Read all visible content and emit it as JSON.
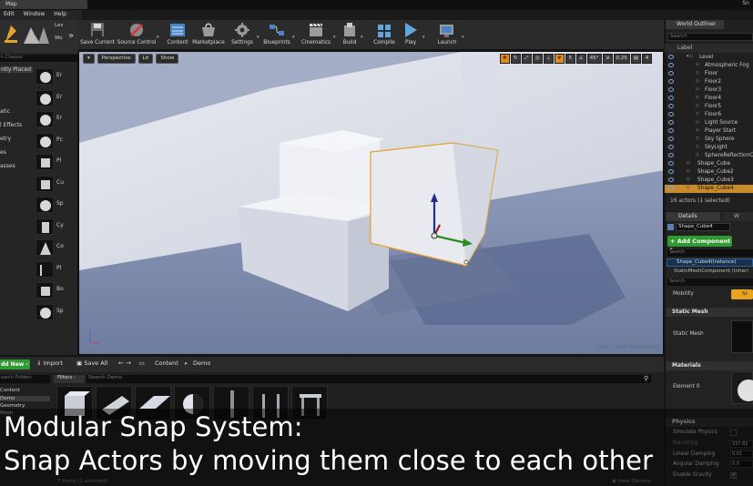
{
  "window": {
    "tab_title": "Map",
    "right_text": "Sn",
    "menu": [
      "Edit",
      "Window",
      "Help"
    ]
  },
  "modes": {
    "tabs": [
      "select-mode",
      "landscape-mode",
      "foliage-mode",
      "mesh-paint-mode"
    ],
    "tab_labels": [
      "Lev",
      "Wo"
    ],
    "search_placeholder": "h Classes",
    "categories": [
      {
        "label": "ntly Placed",
        "selected": true
      },
      {
        "label": ""
      },
      {
        "label": "atic"
      },
      {
        "label": "l Effects"
      },
      {
        "label": "etry"
      },
      {
        "label": "es"
      },
      {
        "label": "asses"
      }
    ],
    "assets": [
      "Er",
      "Er",
      "Er",
      "Pc",
      "Pl",
      "Cu",
      "Sp",
      "Cy",
      "Co",
      "Pl",
      "Bo",
      "Sp"
    ]
  },
  "toolbar": {
    "buttons": [
      {
        "label": "Save Current",
        "icon": "save-icon"
      },
      {
        "label": "Source Control",
        "icon": "source-control-icon"
      },
      {
        "label": "Content",
        "icon": "content-icon"
      },
      {
        "label": "Marketplace",
        "icon": "marketplace-icon"
      },
      {
        "label": "Settings",
        "icon": "settings-icon"
      },
      {
        "label": "Blueprints",
        "icon": "blueprints-icon"
      },
      {
        "label": "Cinematics",
        "icon": "cinematics-icon"
      },
      {
        "label": "Build",
        "icon": "build-icon"
      },
      {
        "label": "Compile",
        "icon": "compile-icon"
      },
      {
        "label": "Play",
        "icon": "play-icon"
      },
      {
        "label": "Launch",
        "icon": "launch-icon"
      }
    ]
  },
  "viewport": {
    "perspective_label": "Perspective",
    "lit_label": "Lit",
    "show_label": "Show",
    "grid_snap_value": "5",
    "rotation_snap_value": "45°",
    "scale_snap_value": "0.25",
    "camera_speed_value": "4",
    "level_label": "Level:  Map (Persistent)",
    "gizmo_colors": {
      "z": "#1f2d8c",
      "x": "#2d8c1f",
      "y": "#8c1f1f",
      "selection": "#e6a12a"
    }
  },
  "outliner": {
    "tab_label": "World Outliner",
    "search_placeholder": "Search",
    "column_label": "Label",
    "items": [
      {
        "label": "Level",
        "indent": 1
      },
      {
        "label": "Atmospheric Fog",
        "indent": 2
      },
      {
        "label": "Floor",
        "indent": 2
      },
      {
        "label": "Floor2",
        "indent": 2
      },
      {
        "label": "Floor3",
        "indent": 2
      },
      {
        "label": "Floor4",
        "indent": 2
      },
      {
        "label": "Floor5",
        "indent": 2
      },
      {
        "label": "Floor6",
        "indent": 2
      },
      {
        "label": "Light Source",
        "indent": 2
      },
      {
        "label": "Player Start",
        "indent": 2
      },
      {
        "label": "Sky Sphere",
        "indent": 2
      },
      {
        "label": "SkyLight",
        "indent": 2
      },
      {
        "label": "SphereReflectionCa",
        "indent": 2
      },
      {
        "label": "Shape_Cube",
        "indent": 1
      },
      {
        "label": "Shape_Cube2",
        "indent": 1
      },
      {
        "label": "Shape_Cube3",
        "indent": 1
      },
      {
        "label": "Shape_Cube4",
        "indent": 1,
        "selected": true
      }
    ],
    "actors_count": "16 actors (1 selected)"
  },
  "details": {
    "tab_label": "Details",
    "tab2_label": "W",
    "name_value": "Shape_Cube4",
    "add_component_label": "+ Add Component -",
    "search_placeholder": "Search",
    "instance_label": "Shape_Cube4(Instance)",
    "component_label": "StaticMeshComponent (Inheri",
    "search2_placeholder": "Search",
    "mobility_label": "Mobility",
    "mobility_value": "St",
    "sections": {
      "static_mesh": "Static Mesh",
      "materials": "Materials",
      "physics": "Physics"
    },
    "static_mesh_label": "Static Mesh",
    "element_label": "Element 0",
    "physics_props": [
      "Simulate Physics",
      "MassInKg",
      "Linear Damping",
      "Angular Damping",
      "Enable Gravity"
    ],
    "physics_values": [
      "",
      "337.82",
      "0.01",
      "0.0",
      ""
    ]
  },
  "content_browser": {
    "add_new_label": "dd New -",
    "import_label": "Import",
    "save_all_label": "Save All",
    "breadcrumb": [
      "Content",
      "Demo"
    ],
    "search_folders_placeholder": "earch Folders",
    "folders": [
      {
        "label": "Content"
      },
      {
        "label": "Demo",
        "selected": true
      },
      {
        "label": "Geometry"
      },
      {
        "label": "Mesh"
      }
    ],
    "filters_label": "Filters -",
    "search_placeholder": "Search Demo",
    "tiles": [
      "cube",
      "cylinder",
      "plane",
      "sphere-half",
      "pillar",
      "arch",
      "column",
      "block"
    ],
    "item_count": "7 items (1 selected)",
    "view_options": "View Options -"
  },
  "caption": {
    "line1": "Modular Snap System:",
    "line2": "Snap Actors by moving them close to each other"
  }
}
